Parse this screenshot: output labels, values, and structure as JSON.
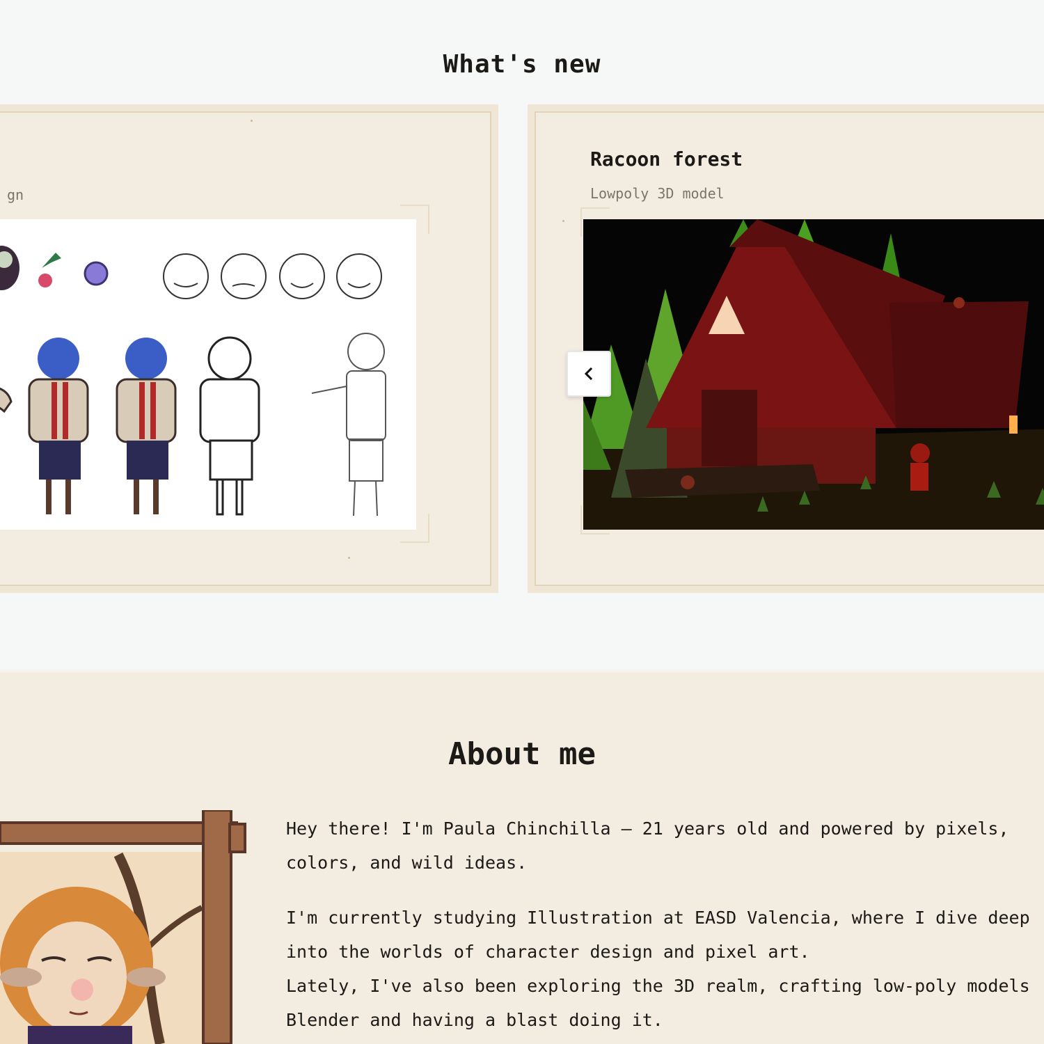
{
  "whats_new": {
    "title": "What's new",
    "left_card": {
      "subtitle_fragment": "gn"
    },
    "right_card": {
      "title": "Racoon forest",
      "subtitle": "Lowpoly 3D model",
      "prev_icon": "chevron-left-icon",
      "active_slide_indicator_color": "#1c6df0"
    }
  },
  "about": {
    "title": "About me",
    "paragraph1": "Hey there! I'm Paula Chinchilla – 21 years old and powered by pixels,\ncolors, and wild ideas.",
    "paragraph2": "I'm currently studying Illustration at EASD Valencia, where I dive deep\ninto the worlds of character design and pixel art.",
    "paragraph3": "Lately, I've also been exploring the 3D realm, crafting low-poly models\nBlender and having a blast doing it."
  },
  "colors": {
    "page_bg": "#f6f8f8",
    "paper": "#f3ede1",
    "accent_dot": "#1c6df0"
  }
}
